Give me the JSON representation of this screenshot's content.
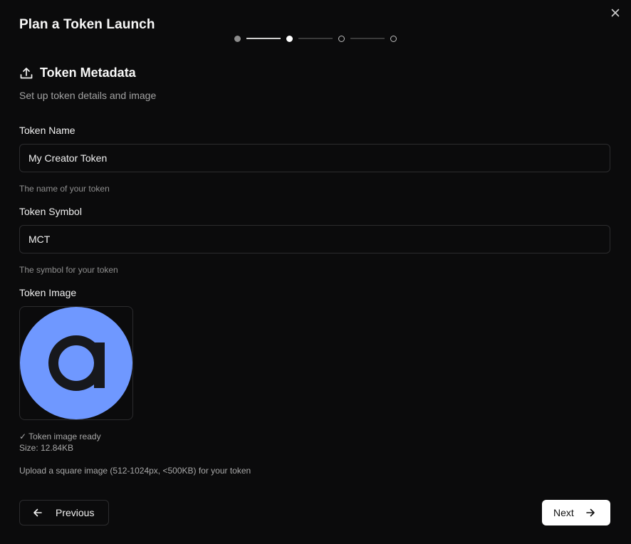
{
  "dialog": {
    "title": "Plan a Token Launch",
    "close_icon": "close-icon"
  },
  "stepper": {
    "steps": [
      "done",
      "active",
      "pending",
      "pending"
    ],
    "current_step": 2,
    "total_steps": 4
  },
  "section": {
    "icon": "upload-icon",
    "title": "Token Metadata",
    "subtitle": "Set up token details and image"
  },
  "fields": {
    "name": {
      "label": "Token Name",
      "value": "My Creator Token",
      "hint": "The name of your token"
    },
    "symbol": {
      "label": "Token Symbol",
      "value": "MCT",
      "hint": "The symbol for your token"
    },
    "image": {
      "label": "Token Image",
      "status": "✓ Token image ready",
      "size": "Size: 12.84KB",
      "hint": "Upload a square image (512-1024px, <500KB) for your token",
      "preview_color": "#6f98ff",
      "glyph_color": "#17181c"
    }
  },
  "footer": {
    "previous_label": "Previous",
    "next_label": "Next",
    "previous_icon": "arrow-left-icon",
    "next_icon": "arrow-right-icon"
  }
}
